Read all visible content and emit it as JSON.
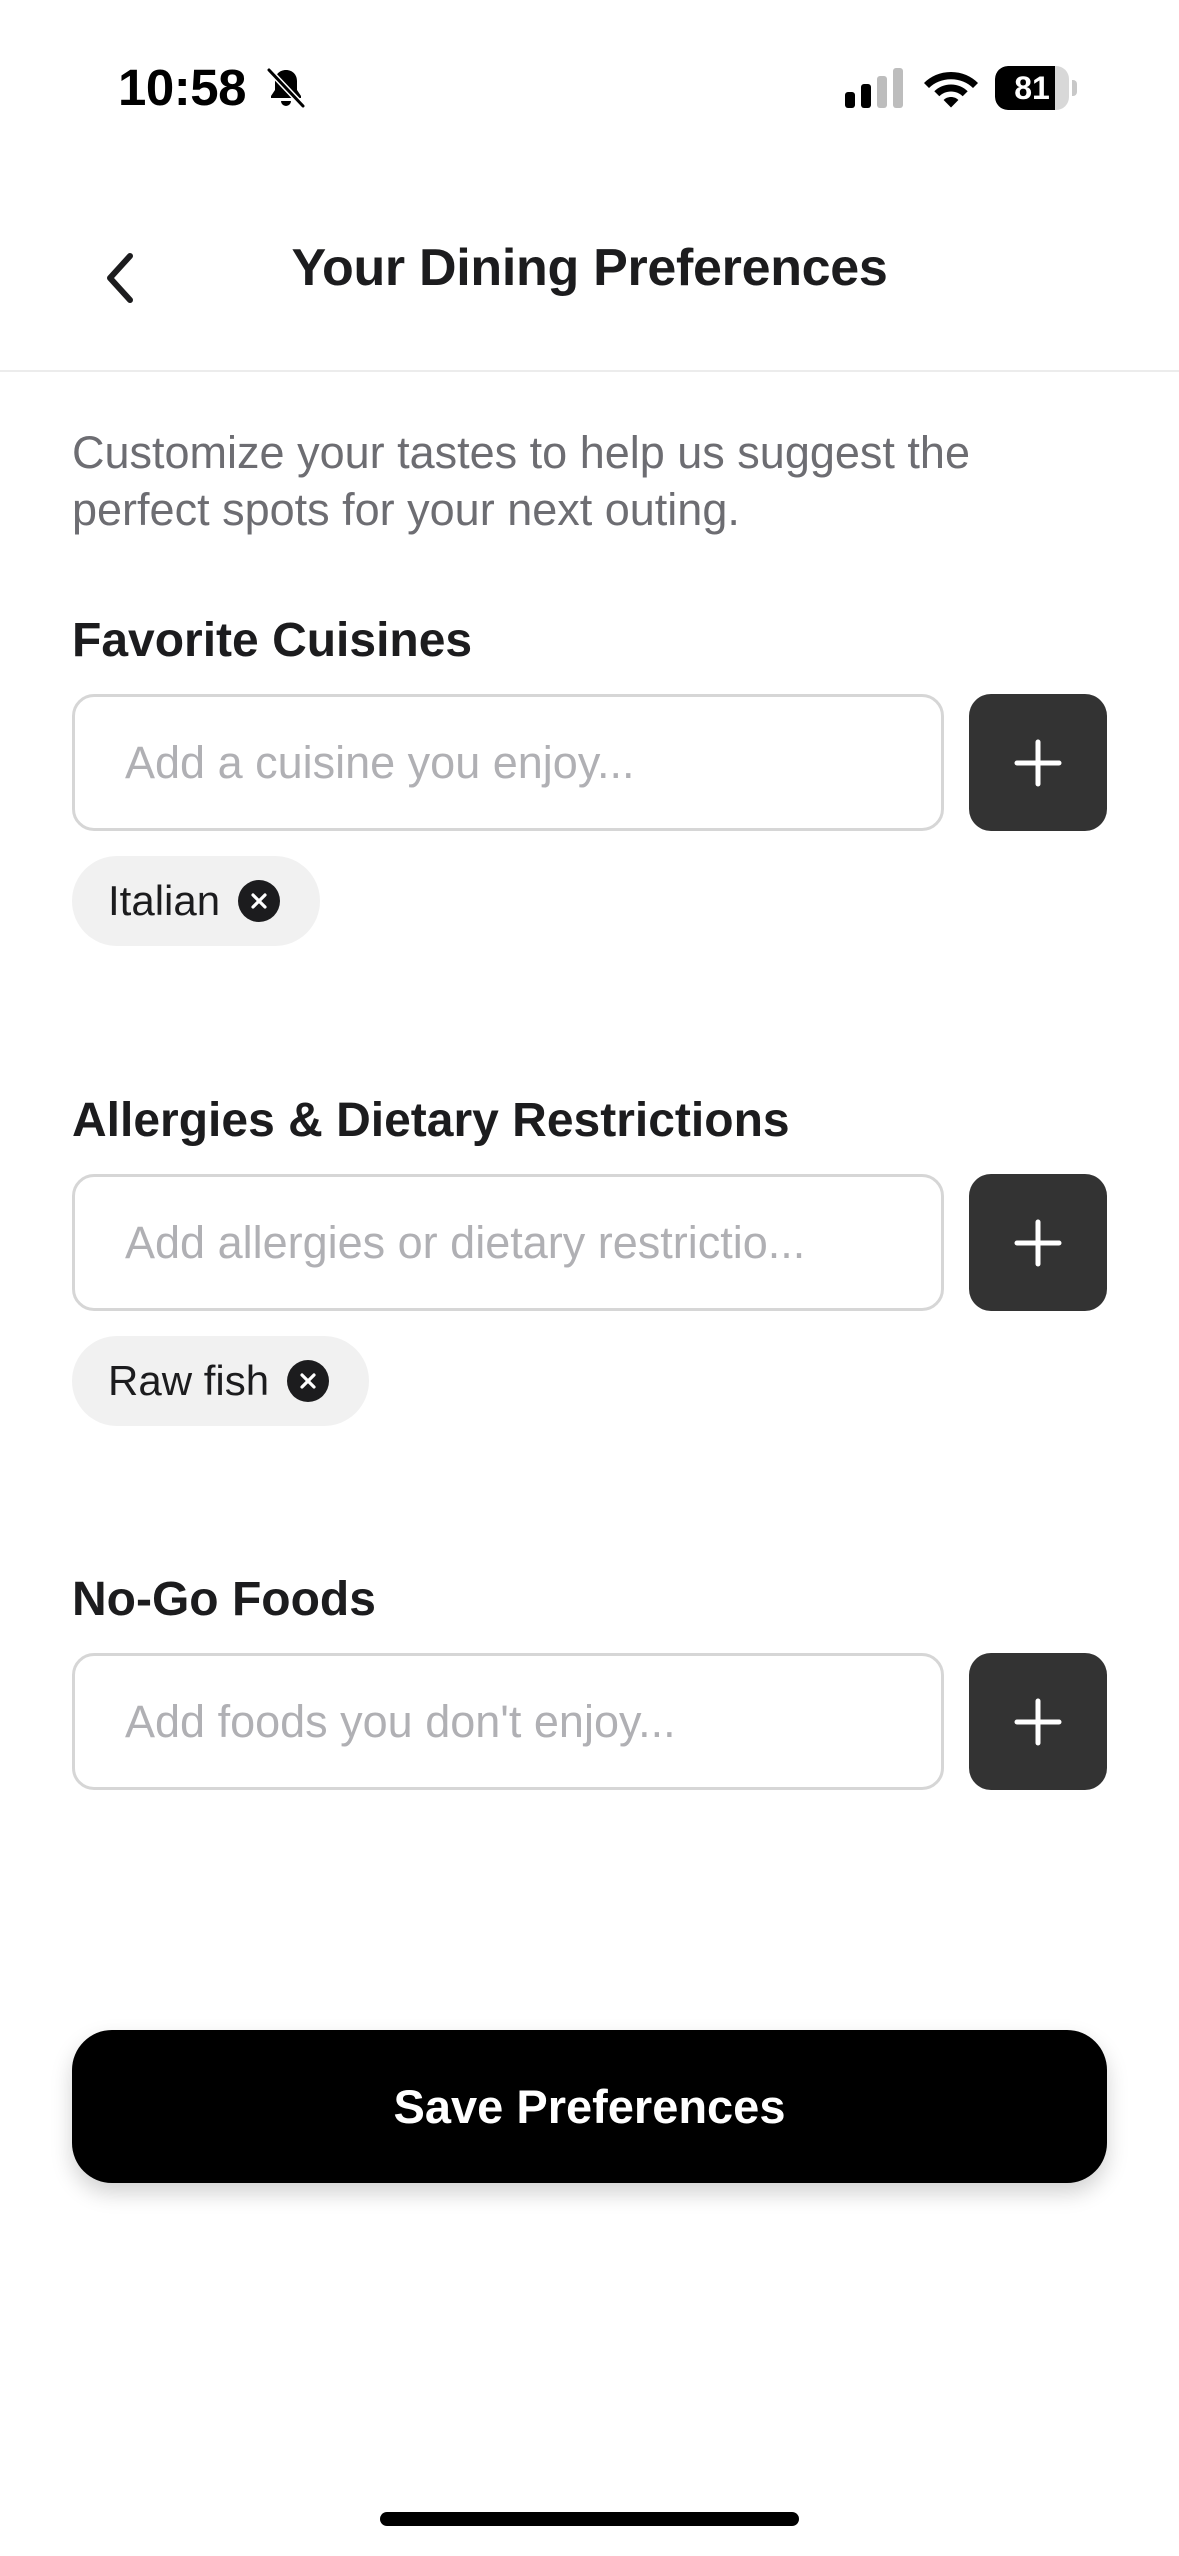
{
  "status_bar": {
    "time": "10:58",
    "battery_level": "81",
    "battery_fraction": 0.81,
    "icons": [
      "bell-slash-icon",
      "signal-icon",
      "wifi-icon",
      "battery-icon"
    ]
  },
  "header": {
    "title": "Your Dining Preferences",
    "back_icon": "chevron-left-icon"
  },
  "intro": {
    "text": "Customize your tastes to help us suggest the perfect spots for your next outing."
  },
  "sections": [
    {
      "label": "Favorite Cuisines",
      "input_placeholder": "Add a cuisine you enjoy...",
      "input_value": "",
      "add_icon": "plus-icon",
      "tags": [
        "Italian"
      ]
    },
    {
      "label": "Allergies & Dietary Restrictions",
      "input_placeholder": "Add allergies or dietary restrictio...",
      "input_value": "",
      "add_icon": "plus-icon",
      "tags": [
        "Raw fish"
      ]
    },
    {
      "label": "No-Go Foods",
      "input_placeholder": "Add foods you don't enjoy...",
      "input_value": "",
      "add_icon": "plus-icon",
      "tags": []
    }
  ],
  "footer": {
    "save_label": "Save Preferences"
  },
  "colors": {
    "accent": "#000000",
    "add_button": "#333333",
    "tag_background": "#f1f1f1",
    "muted_text": "#6d6d72",
    "placeholder": "#b0b0b4"
  }
}
